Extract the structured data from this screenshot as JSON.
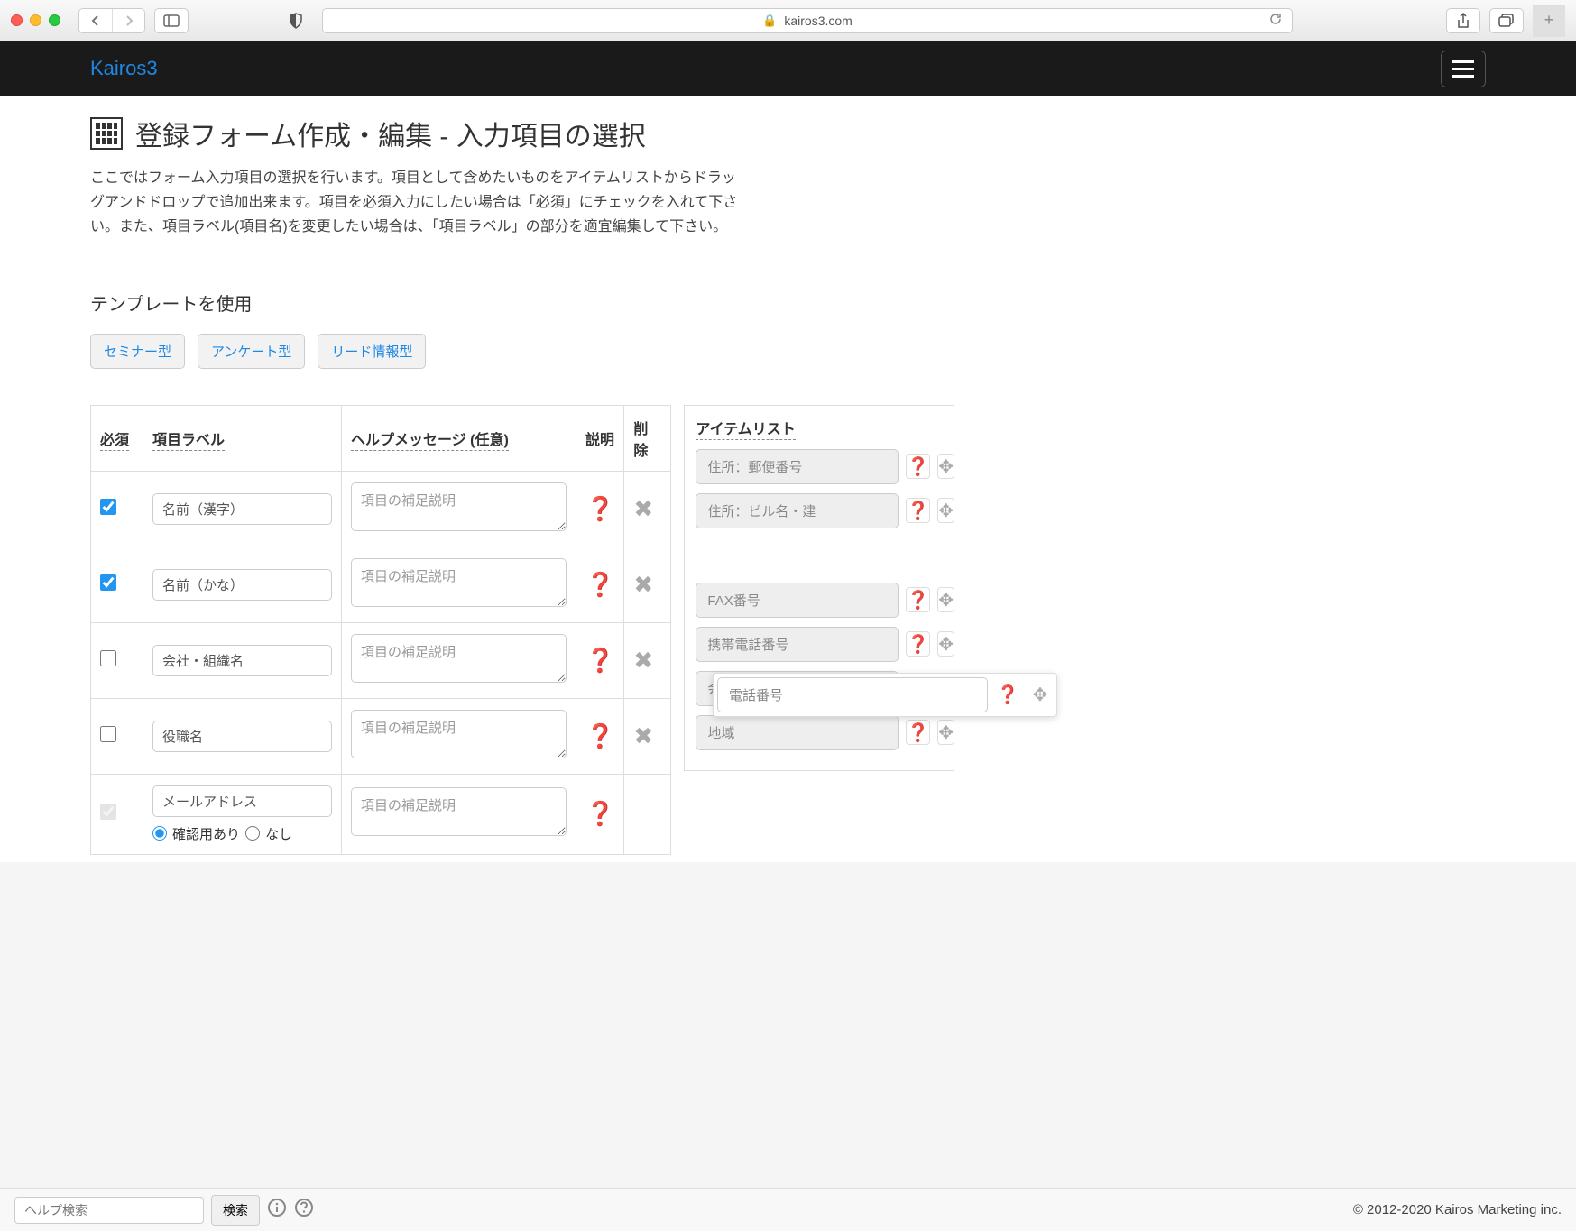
{
  "browser": {
    "url": "kairos3.com"
  },
  "header": {
    "logo": "Kairos3"
  },
  "page": {
    "title": "登録フォーム作成・編集 - 入力項目の選択",
    "description": "ここではフォーム入力項目の選択を行います。項目として含めたいものをアイテムリストからドラッグアンドドロップで追加出来ます。項目を必須入力にしたい場合は「必須」にチェックを入れて下さい。また、項目ラベル(項目名)を変更したい場合は、「項目ラベル」の部分を適宜編集して下さい。"
  },
  "template": {
    "section_label": "テンプレートを使用",
    "buttons": [
      "セミナー型",
      "アンケート型",
      "リード情報型"
    ]
  },
  "table": {
    "headers": {
      "required": "必須",
      "label": "項目ラベル",
      "help": "ヘルプメッセージ (任意)",
      "explain": "説明",
      "delete": "削除"
    },
    "help_placeholder": "項目の補足説明",
    "rows": [
      {
        "required": true,
        "label": "名前（漢字）",
        "has_delete": true
      },
      {
        "required": true,
        "label": "名前（かな）",
        "has_delete": true
      },
      {
        "required": false,
        "label": "会社・組織名",
        "has_delete": true
      },
      {
        "required": false,
        "label": "役職名",
        "has_delete": true
      },
      {
        "required": true,
        "required_disabled": true,
        "label": "メールアドレス",
        "has_delete": false,
        "confirm_options": true
      }
    ],
    "confirm_yes": "確認用あり",
    "confirm_no": "なし"
  },
  "item_list": {
    "header": "アイテムリスト",
    "items": [
      "住所：郵便番号",
      "住所：ビル名・建",
      "FAX番号",
      "携帯電話番号",
      "会社の業種",
      "地域"
    ]
  },
  "dragging": {
    "label": "電話番号"
  },
  "footer": {
    "search_placeholder": "ヘルプ検索",
    "search_button": "検索",
    "copyright": "© 2012-2020 Kairos Marketing inc."
  }
}
